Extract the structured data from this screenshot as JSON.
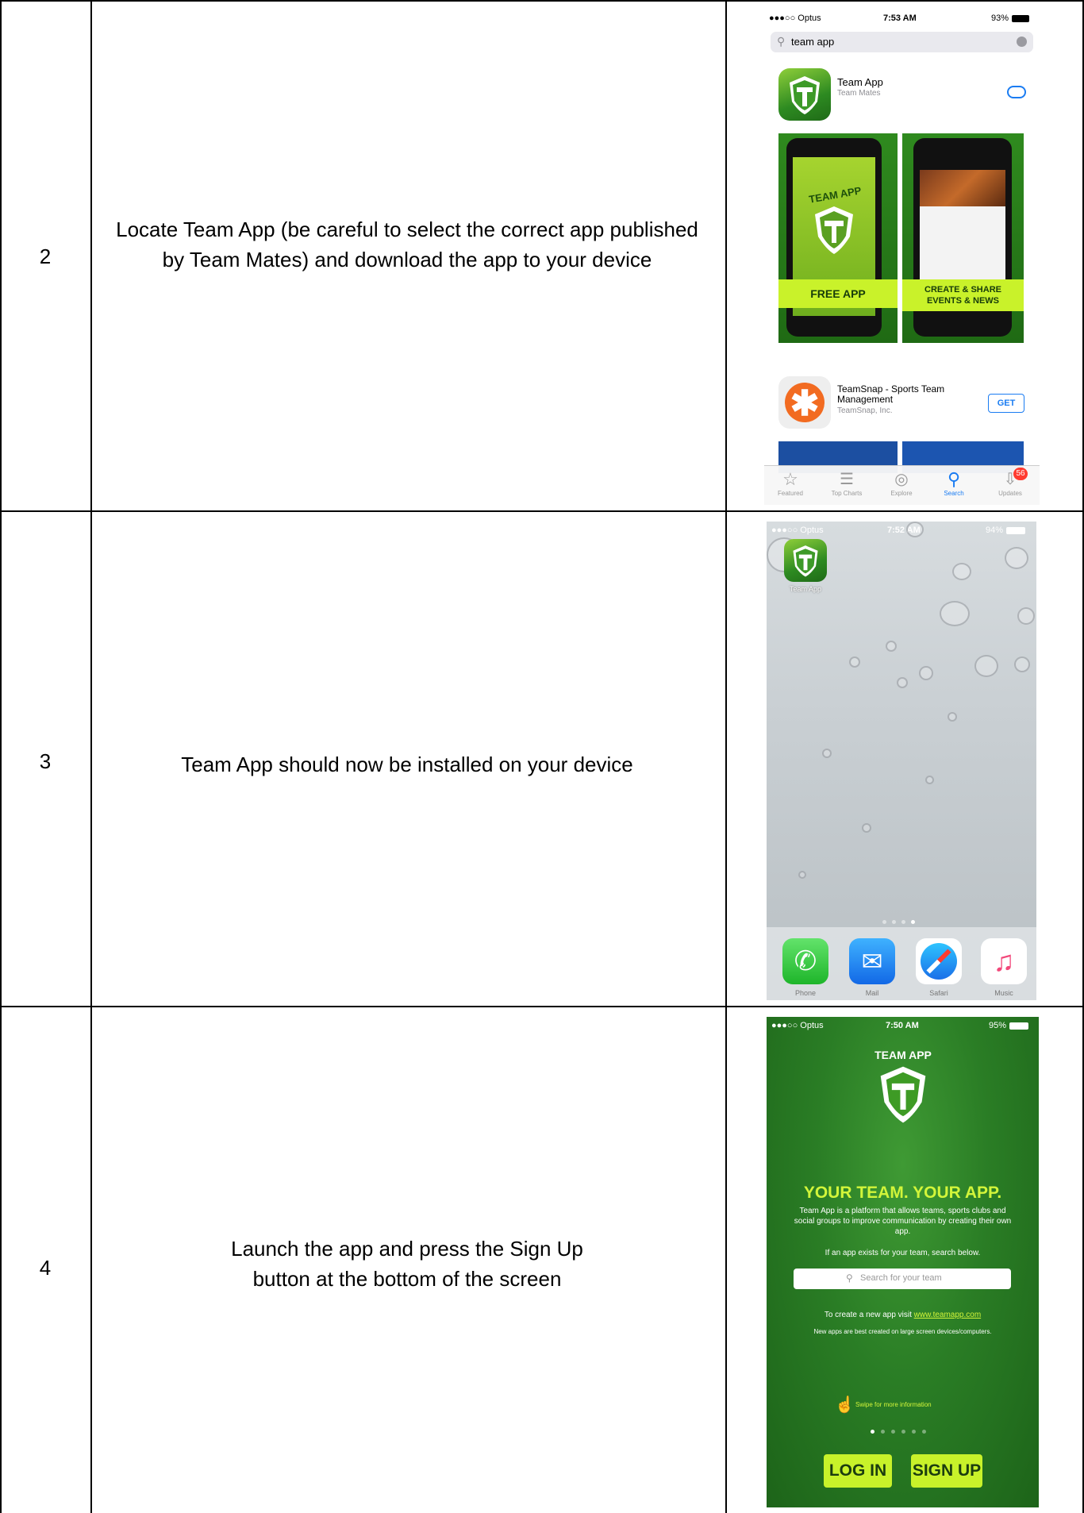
{
  "rows": [
    {
      "number": "2",
      "description": "Locate Team App (be careful to select the correct app published by Team Mates) and download the app to your device"
    },
    {
      "number": "3",
      "description": "Team App should now be installed on your device"
    },
    {
      "number": "4",
      "description": "Launch the app and press the Sign Up button at the bottom of the screen"
    }
  ],
  "screenshot_store": {
    "carrier": "●●●○○ Optus",
    "time": "7:53 AM",
    "battery": "93%",
    "search_query": "team app",
    "result1_name": "Team App",
    "result1_publisher": "Team Mates",
    "promo_left": "FREE APP",
    "promo_right": "CREATE & SHARE EVENTS & NEWS",
    "promo_logo": "TEAM APP",
    "result2_name": "TeamSnap - Sports Team Management",
    "result2_publisher": "TeamSnap, Inc.",
    "get_label": "GET",
    "tabs": [
      "Featured",
      "Top Charts",
      "Explore",
      "Search",
      "Updates"
    ],
    "updates_badge": "56"
  },
  "screenshot_home": {
    "carrier": "●●●○○ Optus",
    "time": "7:52 AM",
    "battery": "94%",
    "app_label": "Team App",
    "dock": [
      "Phone",
      "Mail",
      "Safari",
      "Music"
    ]
  },
  "screenshot_launch": {
    "carrier": "●●●○○ Optus",
    "time": "7:50 AM",
    "battery": "95%",
    "logo": "TEAM APP",
    "headline": "YOUR TEAM. YOUR APP.",
    "intro": "Team App is a platform that allows teams, sports clubs and social groups to improve communication by creating their own app.",
    "search_hint": "If an app exists for your team, search below.",
    "search_placeholder": "Search for your team",
    "create_text": "To create a new app visit",
    "create_link": "www.teamapp.com",
    "note": "New apps are best created on large screen devices/computers.",
    "swipe": "Swipe for more information",
    "login": "LOG IN",
    "signup": "SIGN UP"
  }
}
